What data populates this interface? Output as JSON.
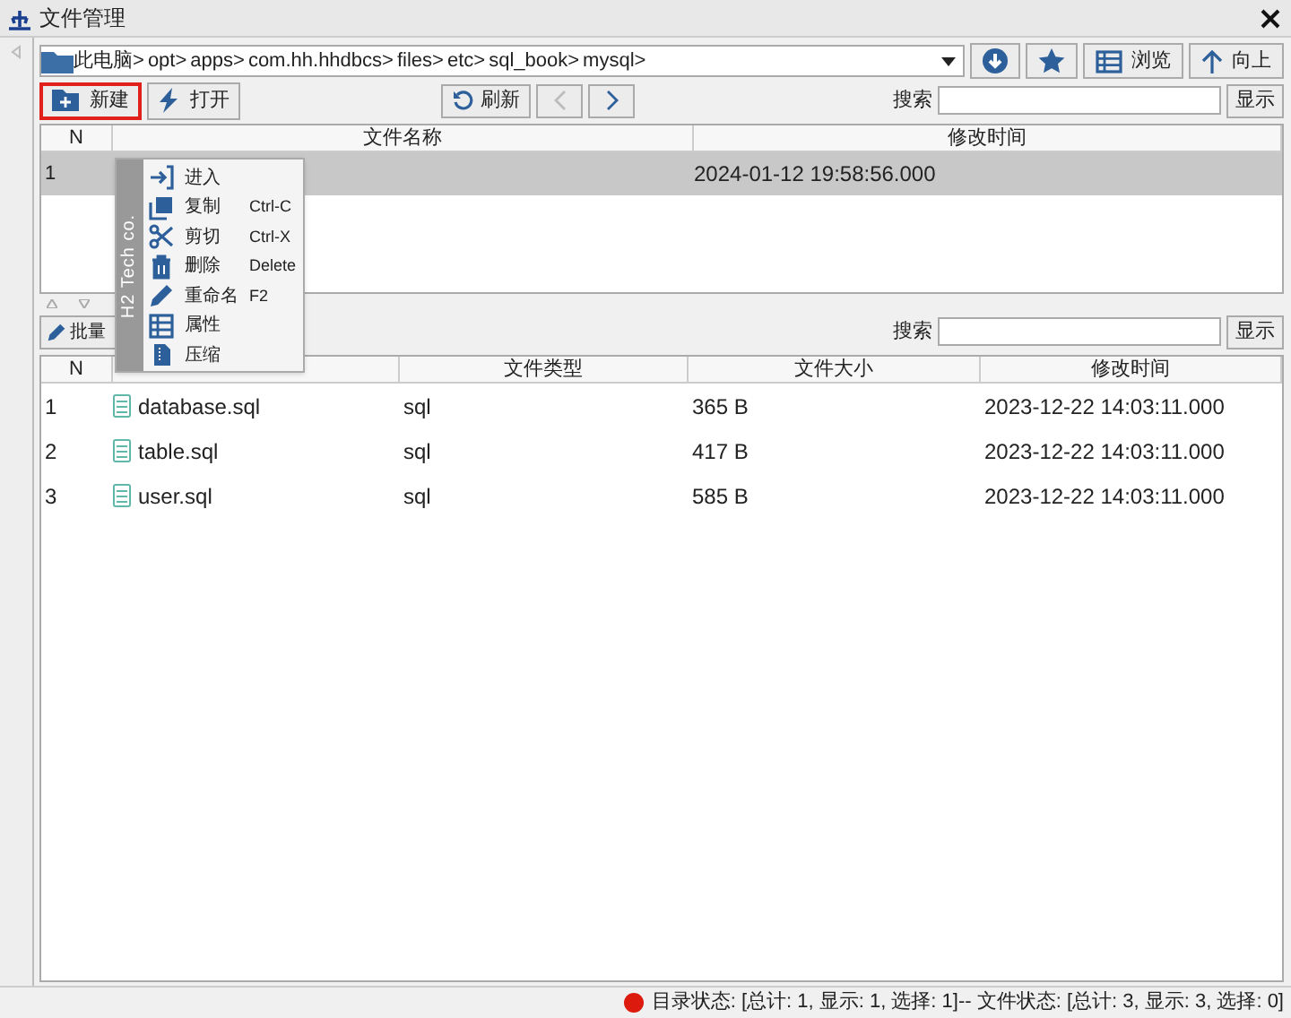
{
  "window": {
    "title": "文件管理"
  },
  "breadcrumb": [
    "此电脑>",
    "opt>",
    "apps>",
    "com.hh.hhdbcs>",
    "files>",
    "etc>",
    "sql_book>",
    "mysql>"
  ],
  "nav_buttons": [
    {
      "kind": "download"
    },
    {
      "kind": "star"
    },
    {
      "kind": "browse",
      "label": "浏览"
    },
    {
      "kind": "up",
      "label": "向上"
    }
  ],
  "actions": [
    {
      "kind": "new",
      "label": "新建",
      "highlighted": true
    },
    {
      "kind": "open",
      "label": "打开",
      "highlighted": false
    }
  ],
  "refresh": {
    "label": "刷新"
  },
  "history": [
    {
      "kind": "back",
      "disabled": true
    },
    {
      "kind": "forward",
      "disabled": false
    }
  ],
  "folder_panel": {
    "search_label": "搜索",
    "show_button": "显示",
    "columns": [
      "N",
      "文件名称",
      "修改时间"
    ],
    "rows": [
      {
        "n": "1",
        "modified": "2024-01-12 19:58:56.000",
        "selected": true
      }
    ]
  },
  "context_menu": {
    "brand": "H2 Tech co.",
    "items": [
      {
        "kind": "enter",
        "label": "进入"
      },
      {
        "kind": "copy",
        "label": "复制",
        "shortcut": "Ctrl-C"
      },
      {
        "kind": "cut",
        "label": "剪切",
        "shortcut": "Ctrl-X"
      },
      {
        "kind": "delete",
        "label": "删除",
        "shortcut": "Delete"
      },
      {
        "kind": "rename",
        "label": "重命名",
        "shortcut": "F2"
      },
      {
        "kind": "properties",
        "label": "属性"
      },
      {
        "kind": "compress",
        "label": "压缩"
      }
    ]
  },
  "file_panel": {
    "batch_button": "批量",
    "search_label": "搜索",
    "show_button": "显示",
    "columns": [
      "N",
      null,
      "文件类型",
      "文件大小",
      "修改时间"
    ],
    "rows": [
      {
        "n": "1",
        "name": "database.sql",
        "type": "sql",
        "size": "365 B",
        "modified": "2023-12-22 14:03:11.000",
        "selected": false
      },
      {
        "n": "2",
        "name": "table.sql",
        "type": "sql",
        "size": "417 B",
        "modified": "2023-12-22 14:03:11.000",
        "selected": false
      },
      {
        "n": "3",
        "name": "user.sql",
        "type": "sql",
        "size": "585 B",
        "modified": "2023-12-22 14:03:11.000",
        "selected": false
      }
    ]
  },
  "status_bar": {
    "color": "#dd1a0e",
    "text": "目录状态: [总计: 1, 显示: 1, 选择: 1]-- 文件状态: [总计: 3, 显示: 3, 选择: 0]"
  }
}
